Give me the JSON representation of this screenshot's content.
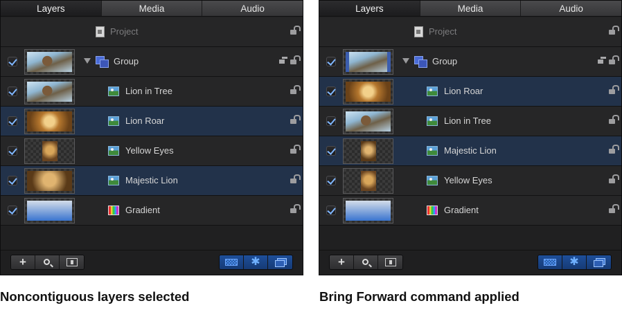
{
  "tabs": [
    "Layers",
    "Media",
    "Audio"
  ],
  "panels": [
    {
      "caption": "Noncontiguous layers selected",
      "project": "Project",
      "group": "Group",
      "layers": [
        {
          "name": "Lion in Tree",
          "selected": false,
          "icon": "image-layer-icon"
        },
        {
          "name": "Lion Roar",
          "selected": true,
          "icon": "image-layer-icon"
        },
        {
          "name": "Yellow Eyes",
          "selected": false,
          "icon": "image-layer-icon"
        },
        {
          "name": "Majestic Lion",
          "selected": true,
          "icon": "image-layer-icon"
        },
        {
          "name": "Gradient",
          "selected": false,
          "icon": "gradient-icon"
        }
      ]
    },
    {
      "caption": "Bring Forward command applied",
      "project": "Project",
      "group": "Group",
      "layers": [
        {
          "name": "Lion Roar",
          "selected": true,
          "icon": "image-layer-icon"
        },
        {
          "name": "Lion in Tree",
          "selected": false,
          "icon": "image-layer-icon"
        },
        {
          "name": "Majestic Lion",
          "selected": true,
          "icon": "image-layer-icon"
        },
        {
          "name": "Yellow Eyes",
          "selected": false,
          "icon": "image-layer-icon"
        },
        {
          "name": "Gradient",
          "selected": false,
          "icon": "gradient-icon"
        }
      ]
    }
  ],
  "toolbar": {
    "left_buttons": [
      "plus-icon",
      "search-icon",
      "frame-icon"
    ],
    "right_buttons": [
      "checkerboard-icon",
      "gear-icon",
      "stack-icon"
    ],
    "plus_glyph": "+",
    "gear_glyph": "✱"
  },
  "colors": {
    "panel_bg": "#202021",
    "row_selected": "#22324a",
    "accent_blue": "#6fb0ff",
    "active_toggle": "#1e4f9a"
  }
}
